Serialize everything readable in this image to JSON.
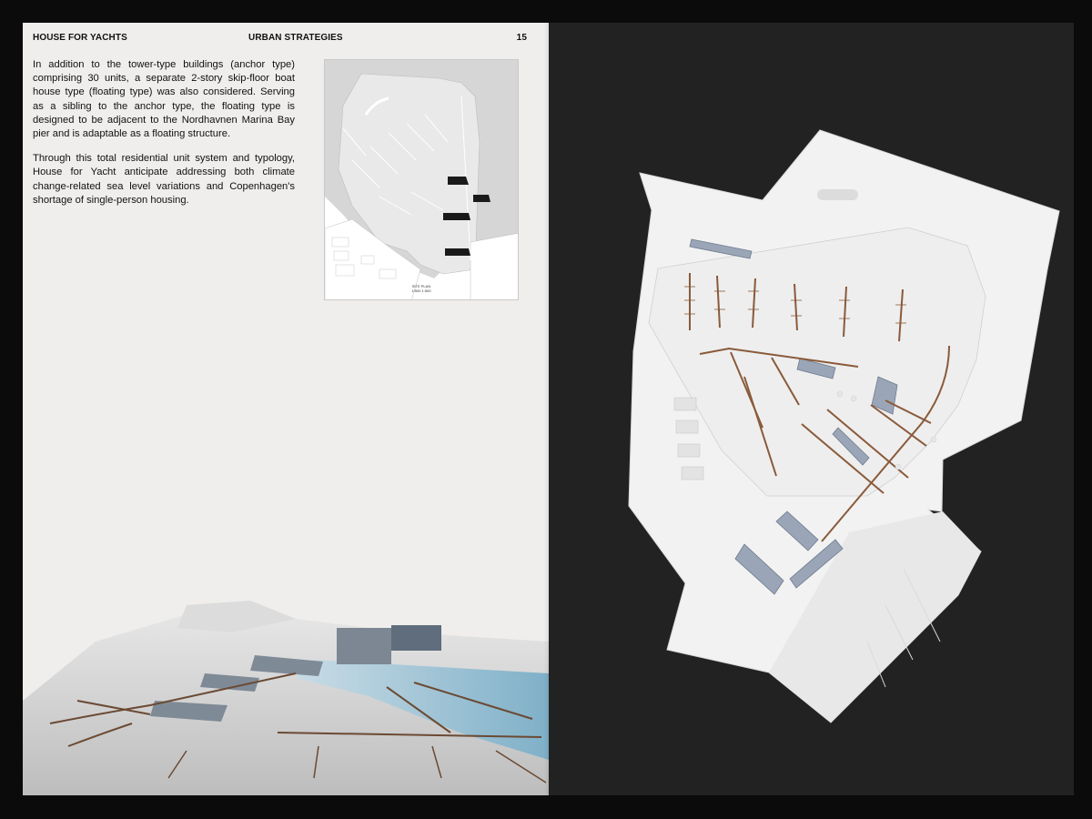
{
  "left_page": {
    "running_head": {
      "left": "HOUSE FOR YACHTS",
      "center": "URBAN STRATEGIES",
      "page_number": "15"
    },
    "paragraphs": [
      "In addition to the tower-type buildings (anchor type) comprising 30 units, a separate 2-story skip-floor boat house type (floating type) was also considered. Serving as a sibling to the anchor type, the floating type is designed to be adjacent to the Nordhavnen Marina Bay pier and is adaptable as a floating structure.",
      "Through this total residential unit system and typology, House for Yacht anticipate addressing both climate change-related sea level variations and Copenhagen's shortage of single-person housing."
    ],
    "site_plan": {
      "caption_line1": "SITE PLAN",
      "caption_line2": "1/500 1:500"
    }
  },
  "colors": {
    "paper": "#efeeec",
    "background": "#0b0b0b",
    "right_page": "#222222",
    "model_white": "#f2f2f2",
    "pier_copper": "#8a5a3a",
    "building_blue": "#8c9bb0"
  }
}
